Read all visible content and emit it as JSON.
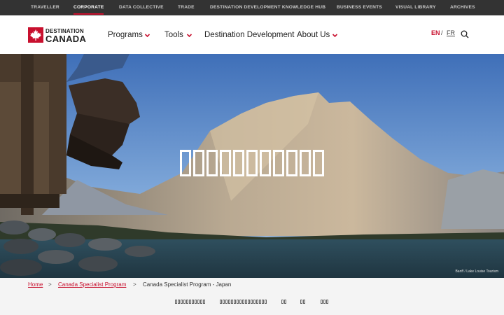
{
  "top_nav": {
    "items": [
      "TRAVELLER",
      "CORPORATE",
      "DATA COLLECTIVE",
      "TRADE",
      "DESTINATION DEVELOPMENT KNOWLEDGE HUB",
      "BUSINESS EVENTS",
      "VISUAL LIBRARY",
      "ARCHIVES"
    ],
    "active": "CORPORATE"
  },
  "header": {
    "logo_line1": "DESTINATION",
    "logo_line2": "CANADA",
    "nav": [
      "Programs",
      "Tools",
      "Destination Development",
      "About Us"
    ],
    "lang_en": "EN",
    "lang_sep": "/",
    "lang_fr": "FR",
    "icons": {
      "logo": "maple-leaf-icon",
      "search": "search-icon",
      "dropdown": "chevron-down-icon"
    }
  },
  "hero": {
    "title_glyph_count": 11,
    "credit": "Banff / Lake Louise Tourism"
  },
  "breadcrumb": {
    "home": "Home",
    "sep": ">",
    "program": "Canada Specialist Program",
    "current": "Canada Specialist Program - Japan"
  },
  "subnav": {
    "glyph_counts": [
      11,
      17,
      2,
      2,
      3
    ]
  },
  "colors": {
    "brand_red": "#c8102e",
    "topbar_bg": "#333333",
    "breadcrumb_bg": "#f4f4f4"
  }
}
